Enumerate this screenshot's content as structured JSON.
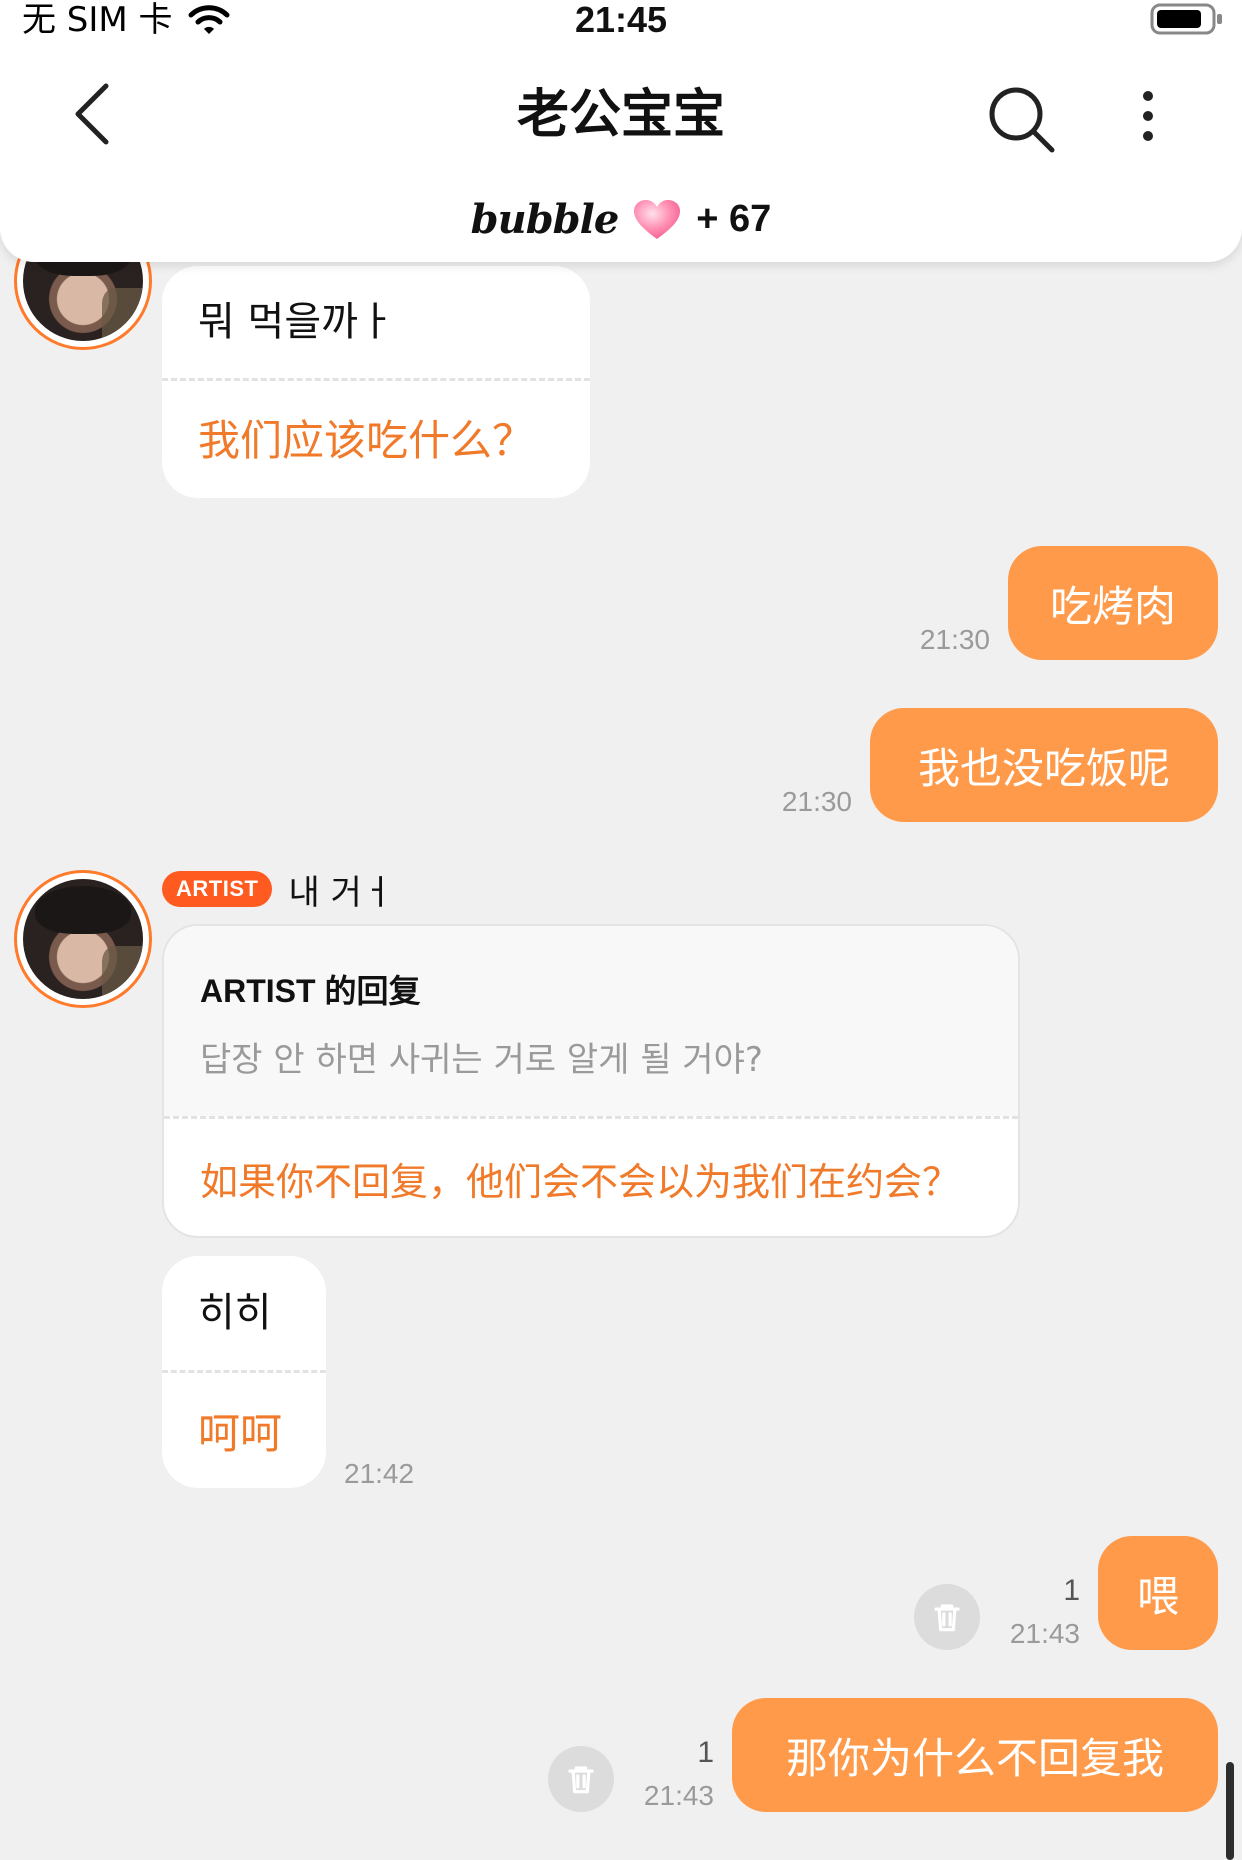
{
  "status_bar": {
    "carrier": "无 SIM 卡",
    "time": "21:45"
  },
  "nav": {
    "title": "老公宝宝",
    "brand": "bubble",
    "brand_count": "+ 67"
  },
  "colors": {
    "accent": "#ff9a4a",
    "translation": "#f07a2a",
    "artist_badge": "#ff5a1f",
    "background": "#f0f0f0"
  },
  "messages": {
    "m1": {
      "original": "뭐 먹을까ㅏ",
      "translation": "我们应该吃什么？"
    },
    "m2": {
      "text": "吃烤肉",
      "time": "21:30"
    },
    "m3": {
      "text": "我也没吃饭呢",
      "time": "21:30"
    },
    "artist": {
      "badge": "ARTIST",
      "name": "내 거ㅓ"
    },
    "reply": {
      "label": "ARTIST 的回复",
      "quote": "답장 안 하면 사귀는 거로 알게 될 거야?",
      "translation": "如果你不回复，他们会不会以为我们在约会？"
    },
    "m4": {
      "original": "히히",
      "translation": "呵呵",
      "time": "21:42"
    },
    "m5": {
      "text": "喂",
      "time": "21:43",
      "unread": "1"
    },
    "m6": {
      "text": "那你为什么不回复我",
      "time": "21:43",
      "unread": "1"
    }
  }
}
